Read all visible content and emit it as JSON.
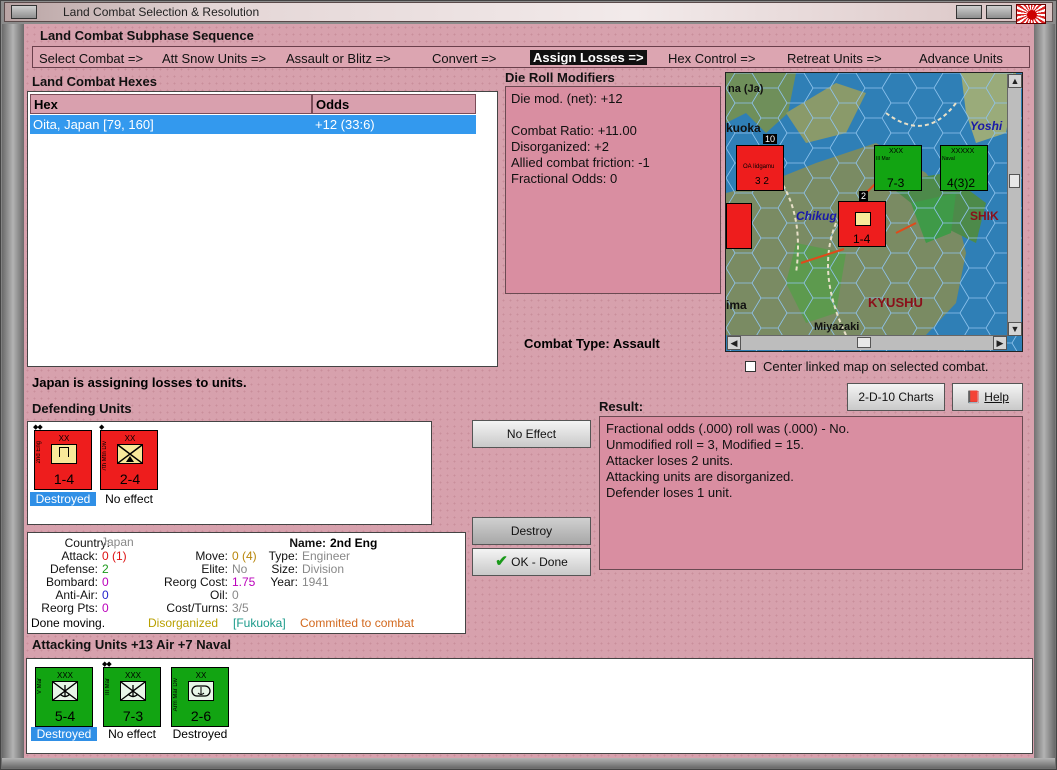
{
  "window": {
    "title": "Land Combat Selection & Resolution"
  },
  "subphase": {
    "title": "Land Combat Subphase Sequence",
    "steps": [
      "Select Combat =>",
      "Att Snow Units =>",
      "Assault or Blitz =>",
      "Convert =>",
      "Assign Losses =>",
      "Hex Control =>",
      "Retreat Units =>",
      "Advance Units"
    ],
    "active_index": 4
  },
  "hexes": {
    "title": "Land Combat Hexes",
    "col_hex": "Hex",
    "col_odds": "Odds",
    "rows": [
      {
        "hex": "Oita, Japan [79, 160]",
        "odds": "+12 (33:6)"
      }
    ]
  },
  "die_roll": {
    "title": "Die Roll Modifiers",
    "lines": [
      "Die mod. (net): +12",
      "",
      "Combat Ratio: +11.00",
      "Disorganized: +2",
      "Allied combat friction: -1",
      "Fractional Odds: 0"
    ]
  },
  "combat_type": {
    "label": "Combat Type:",
    "value": "Assault"
  },
  "map": {
    "labels": [
      "na (Ja)",
      "kuoka",
      "Yoshi",
      "Chikug",
      "SHIK",
      "KYUSHU",
      "ima",
      "Miyazaki"
    ],
    "counters": [
      {
        "top": "10",
        "name": "OA Iidgamu",
        "val": "3 2"
      },
      {
        "top": "XXX",
        "name": "III Mar",
        "val": "7-3"
      },
      {
        "top": "XXXXX",
        "name": "Naval",
        "val": "4(3)2"
      },
      {
        "top": "2",
        "name": "2nd Eng",
        "val": "1-4"
      }
    ]
  },
  "center_map": {
    "label": "Center linked map on selected combat.",
    "checked": false
  },
  "buttons": {
    "charts": "2-D-10 Charts",
    "help": "Help",
    "no_effect": "No Effect",
    "destroy": "Destroy",
    "ok_done": "OK - Done"
  },
  "status_line": "Japan is assigning losses to units.",
  "defending": {
    "title": "Defending Units",
    "units": [
      {
        "name": "2nd Eng",
        "xx": "XX",
        "val": "1-4",
        "status": "Destroyed",
        "selected": true
      },
      {
        "name": "7th Mtn Div",
        "xx": "XX",
        "val": "2-4",
        "status": "No effect",
        "selected": false
      }
    ]
  },
  "unit_info": {
    "country_label": "Country:",
    "country": "Japan",
    "attack_label": "Attack:",
    "attack": "0",
    "attack_paren": "(1)",
    "defense_label": "Defense:",
    "defense": "2",
    "bombard_label": "Bombard:",
    "bombard": "0",
    "antiair_label": "Anti-Air:",
    "antiair": "0",
    "reorgpts_label": "Reorg Pts:",
    "reorgpts": "0",
    "move_label": "Move:",
    "move": "0",
    "move_paren": "(4)",
    "elite_label": "Elite:",
    "elite": "No",
    "reorgcost_label": "Reorg Cost:",
    "reorgcost": "1.75",
    "oil_label": "Oil:",
    "oil": "0",
    "costturns_label": "Cost/Turns:",
    "costturns": "3/5",
    "name_label": "Name:",
    "name": "2nd Eng",
    "type_label": "Type:",
    "type": "Engineer",
    "size_label": "Size:",
    "size": "Division",
    "year_label": "Year:",
    "year": "1941",
    "status_moving": "Done moving.",
    "status_disorg": "Disorganized",
    "status_loc": "[Fukuoka]",
    "status_committed": "Committed to combat"
  },
  "result": {
    "title": "Result:",
    "lines": [
      "Fractional odds (.000) roll was (.000)  - No.",
      "Unmodified roll = 3, Modified = 15.",
      "Attacker loses 2 units.",
      "Attacking units are disorganized.",
      "Defender loses 1 unit."
    ]
  },
  "attacking": {
    "title": "Attacking Units +13 Air +7 Naval",
    "units": [
      {
        "name": "V Mar",
        "xx": "XXX",
        "val": "5-4",
        "status": "Destroyed",
        "selected": true
      },
      {
        "name": "III Mar",
        "xx": "XXX",
        "val": "7-3",
        "status": "No effect",
        "selected": false
      },
      {
        "name": "Arm Mar Div",
        "xx": "XX",
        "val": "2-6",
        "status": "Destroyed",
        "selected": false
      }
    ]
  },
  "colors": {
    "panel": "#d7a1ad",
    "highlight": "#3399ee",
    "red_unit": "#ee1d1d",
    "green_unit": "#12a412"
  }
}
